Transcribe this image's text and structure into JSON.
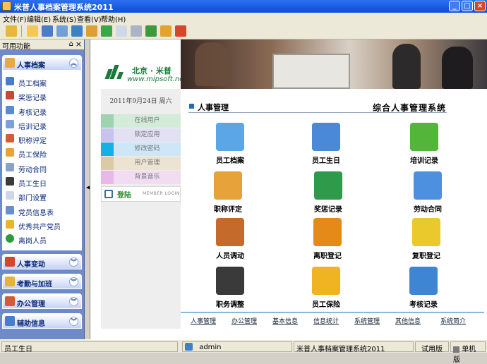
{
  "window": {
    "title": "米普人事档案管理系统2011"
  },
  "menu": [
    "文件(F)",
    "编辑(E)",
    "系统(S)",
    "查看(V)",
    "帮助(H)"
  ],
  "sidebar": {
    "header": "可用功能",
    "groups": [
      {
        "label": "人事档案",
        "expanded": true
      },
      {
        "label": "人事变动",
        "expanded": false
      },
      {
        "label": "考勤与加班",
        "expanded": false
      },
      {
        "label": "办公管理",
        "expanded": false
      },
      {
        "label": "辅助信息",
        "expanded": false
      }
    ],
    "items": [
      {
        "label": "员工档案",
        "icon": "folder-icon"
      },
      {
        "label": "奖惩记录",
        "icon": "award-icon"
      },
      {
        "label": "考核记录",
        "icon": "checklist-icon"
      },
      {
        "label": "培训记录",
        "icon": "pen-icon"
      },
      {
        "label": "职称评定",
        "icon": "medal-icon"
      },
      {
        "label": "员工保险",
        "icon": "shield-icon"
      },
      {
        "label": "劳动合同",
        "icon": "contract-icon"
      },
      {
        "label": "员工生日",
        "icon": "cake-icon"
      },
      {
        "label": "部门设置",
        "icon": "document-icon"
      },
      {
        "label": "党员信息表",
        "icon": "table-icon"
      },
      {
        "label": "优秀共产党员",
        "icon": "star-icon"
      },
      {
        "label": "离岗人员",
        "icon": "exit-icon"
      }
    ]
  },
  "main": {
    "logo": {
      "name": "北京 · 米普",
      "url": "www.mipsoft.net"
    },
    "date": "2011年9月24日 周六",
    "left_buttons": [
      {
        "label": "在线用户",
        "color": "#d3ecd9"
      },
      {
        "label": "锁定应用",
        "color": "#e2e0f3"
      },
      {
        "label": "修改密码",
        "color": "#cde7f6"
      },
      {
        "label": "用户管理",
        "color": "#ece3d2"
      },
      {
        "label": "背景音乐",
        "color": "#f1dcf2"
      }
    ],
    "login": {
      "label": "登陆",
      "sub": "MEMBER LOGIN"
    },
    "section_title": "人事管理",
    "system_title": "综合人事管理系统",
    "tiles": [
      {
        "label": "员工档案",
        "icon": "file-icon",
        "color": "#5aa6e6"
      },
      {
        "label": "员工生日",
        "icon": "finder-icon",
        "color": "#4a88d8"
      },
      {
        "label": "培训记录",
        "icon": "download-icon",
        "color": "#53b53a"
      },
      {
        "label": "职称评定",
        "icon": "paint-icon",
        "color": "#e7a23a"
      },
      {
        "label": "奖惩记录",
        "icon": "book-icon",
        "color": "#2f9a4a"
      },
      {
        "label": "劳动合同",
        "icon": "folder-icon",
        "color": "#4d90e0"
      },
      {
        "label": "人员调动",
        "icon": "exit-door-icon",
        "color": "#c46a2a"
      },
      {
        "label": "离职登记",
        "icon": "runner-icon",
        "color": "#e58a18"
      },
      {
        "label": "复职登记",
        "icon": "warning-sign-icon",
        "color": "#e9c92c"
      },
      {
        "label": "职务调整",
        "icon": "group-icon",
        "color": "#3a3a3a"
      },
      {
        "label": "员工保险",
        "icon": "pacman-icon",
        "color": "#f0b321"
      },
      {
        "label": "考核记录",
        "icon": "folders-icon",
        "color": "#3e86d4"
      }
    ],
    "links": [
      "人事管理",
      "办公管理",
      "基本信息",
      "信息统计",
      "系统管理",
      "其他信息",
      "系统简介"
    ]
  },
  "status": {
    "current": "员工生日",
    "user": "admin",
    "app": "米普人事档案管理系统2011",
    "edition": "试用版",
    "mode": "单机版"
  }
}
